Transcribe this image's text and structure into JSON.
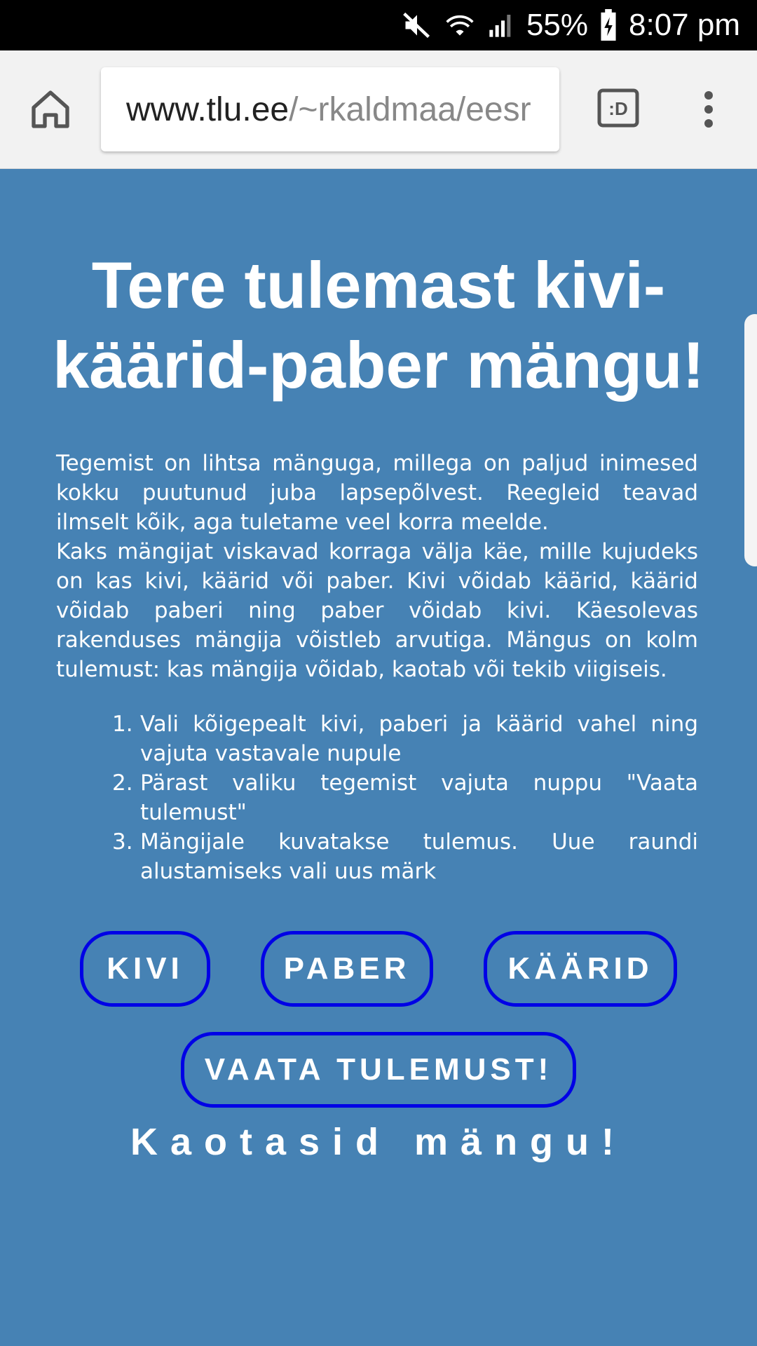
{
  "status_bar": {
    "battery": "55%",
    "time": "8:07 pm",
    "icons": [
      "mute-icon",
      "wifi-icon",
      "signal-icon",
      "battery-charging-icon"
    ]
  },
  "browser": {
    "url_host": "www.tlu.ee",
    "url_path": "/~rkaldmaa/eesr",
    "tab_switcher_label": ":D",
    "icons": [
      "home-icon",
      "tab-switcher-icon",
      "more-vert-icon"
    ]
  },
  "page": {
    "title": "Tere tulemast kivi-käärid-paber mängu!",
    "intro_p1": "Tegemist on lihtsa mänguga, millega on paljud inimesed kokku puutunud juba lapsepõlvest. Reegleid teavad ilmselt kõik, aga tuletame veel korra meelde.",
    "intro_p2": "Kaks mängijat viskavad korraga välja käe, mille kujudeks on kas kivi, käärid või paber. Kivi võidab käärid, käärid võidab paberi ning paber võidab kivi. Käesolevas rakenduses mängija võistleb arvutiga. Mängus on kolm tulemust: kas mängija võidab, kaotab või tekib viigiseis.",
    "steps": [
      {
        "num": "1.",
        "text": "Vali kõigepealt kivi, paberi ja käärid vahel ning vajuta vastavale nupule"
      },
      {
        "num": "2.",
        "text": "Pärast valiku tegemist vajuta nuppu \"Vaata tulemust\""
      },
      {
        "num": "3.",
        "text": "Mängijale kuvatakse tulemus. Uue raundi alustamiseks vali uus märk"
      }
    ],
    "buttons": {
      "kivi": "KIVI",
      "paber": "PABER",
      "kaarid": "KÄÄRID",
      "result": "VAATA TULEMUST!"
    },
    "result_message": "Kaotasid mängu!"
  },
  "colors": {
    "page_background": "#4682B4",
    "button_border": "#0000e6",
    "text": "#ffffff"
  }
}
